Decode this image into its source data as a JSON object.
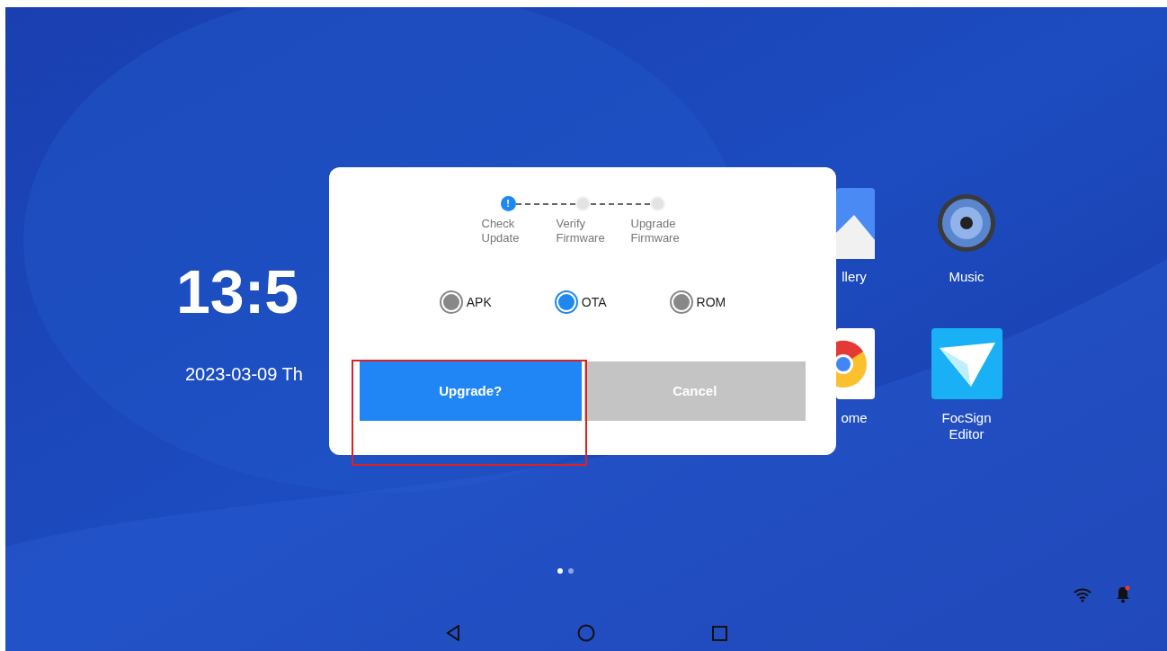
{
  "clock": {
    "time": "13:5",
    "date": "2023-03-09 Th"
  },
  "apps": [
    {
      "label": "llery",
      "kind": "gallery"
    },
    {
      "label": "Music",
      "kind": "music"
    },
    {
      "label": "ome",
      "kind": "chrome"
    },
    {
      "label": "FocSign Editor",
      "kind": "focsign"
    }
  ],
  "page_dots": [
    {
      "selected": true
    },
    {
      "selected": false
    }
  ],
  "dialog": {
    "steps": [
      {
        "label": "Check Update",
        "selected": true,
        "symbol": "!"
      },
      {
        "label": "Verify Firmware",
        "selected": false
      },
      {
        "label": "Upgrade Firmware",
        "selected": false
      }
    ],
    "options": [
      {
        "label": "APK",
        "selected": false
      },
      {
        "label": "OTA",
        "selected": true
      },
      {
        "label": "ROM",
        "selected": false
      }
    ],
    "buttons": [
      {
        "label": "Upgrade?",
        "kind": "primary"
      },
      {
        "label": "Cancel",
        "kind": "secondary"
      }
    ],
    "highlight": true
  }
}
